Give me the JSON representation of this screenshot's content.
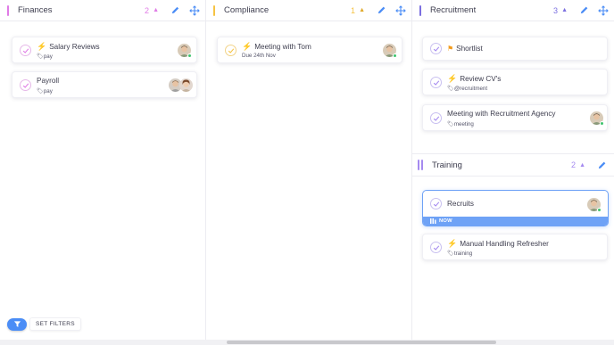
{
  "colors": {
    "finances_accent": "#e07be6",
    "compliance_accent": "#f6c343",
    "recruitment_accent": "#7b6fe0",
    "training_accent": "#a58af0",
    "icon_blue": "#4b8df6",
    "now_blue": "#6ea2f6"
  },
  "columns": {
    "finances": {
      "title": "Finances",
      "count": "2",
      "cards": [
        {
          "title": "Salary Reviews",
          "tag": "pay",
          "priority_icon": "lightning-icon"
        },
        {
          "title": "Payroll",
          "tag": "pay"
        }
      ]
    },
    "compliance": {
      "title": "Compliance",
      "count": "1",
      "cards": [
        {
          "title": "Meeting with Tom",
          "due": "Due 24th Nov",
          "priority_icon": "lightning-red-icon"
        }
      ]
    },
    "recruitment": {
      "title": "Recruitment",
      "count": "3",
      "cards": [
        {
          "title": "Shortlist",
          "priority_icon": "flag-icon"
        },
        {
          "title": "Review CV's",
          "tag": "@recruitment",
          "priority_icon": "lightning-icon"
        },
        {
          "title": "Meeting with Recruitment Agency",
          "tag": "meeting"
        }
      ]
    },
    "training": {
      "title": "Training",
      "count": "2",
      "cards": [
        {
          "title": "Recruits",
          "status": "NOW"
        },
        {
          "title": "Manual Handling Refresher",
          "tag": "training",
          "priority_icon": "lightning-icon"
        }
      ]
    }
  },
  "filters": {
    "label": "SET FILTERS"
  },
  "icons": {
    "sort": "▲",
    "edit": "pencil-icon",
    "move": "move-arrows-icon",
    "tag": "tag-icon",
    "filter": "funnel-icon"
  }
}
